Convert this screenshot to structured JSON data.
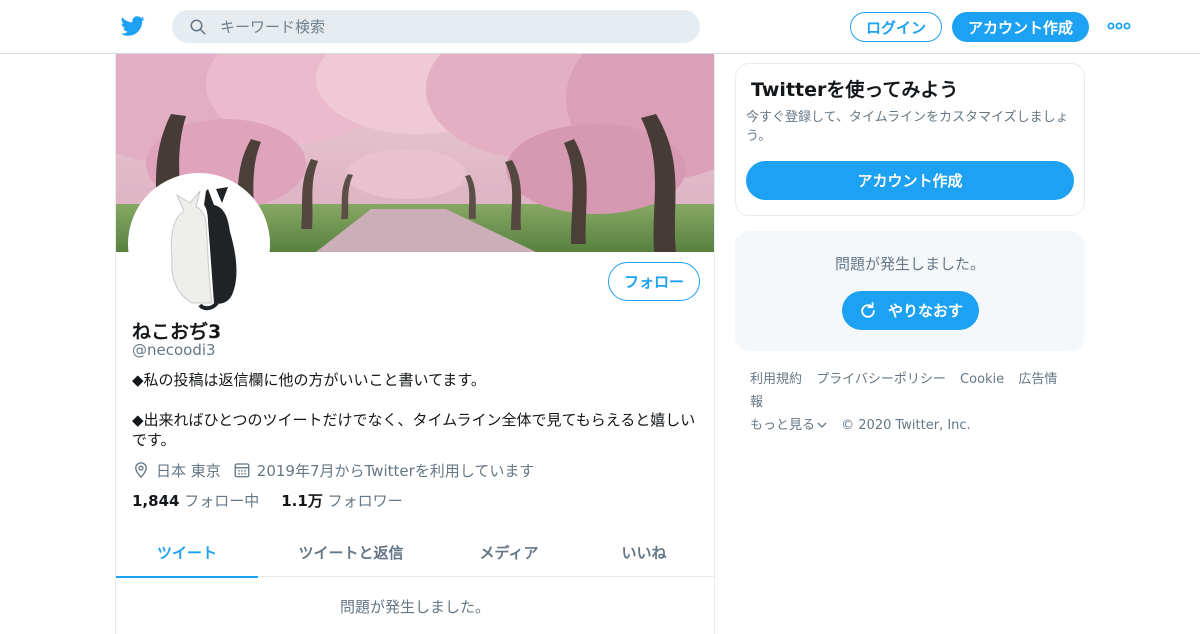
{
  "topbar": {
    "search_placeholder": "キーワード検索",
    "login_label": "ログイン",
    "signup_label": "アカウント作成"
  },
  "profile": {
    "follow_label": "フォロー",
    "display_name": "ねこおぢ3",
    "handle": "@necoodi3",
    "bio_line1": "◆私の投稿は返信欄に他の方がいいこと書いてます。",
    "bio_line2": "◆出来ればひとつのツイートだけでなく、タイムライン全体で見てもらえると嬉しいです。",
    "location": "日本 東京",
    "joined": "2019年7月からTwitterを利用しています",
    "following_count": "1,844",
    "following_label": "フォロー中",
    "followers_count": "1.1万",
    "followers_label": "フォロワー",
    "tabs": [
      {
        "label": "ツイート"
      },
      {
        "label": "ツイートと返信"
      },
      {
        "label": "メディア"
      },
      {
        "label": "いいね"
      }
    ],
    "error_text": "問題が発生しました。"
  },
  "sidebar": {
    "signup_title": "Twitterを使ってみよう",
    "signup_desc": "今すぐ登録して、タイムラインをカスタマイズしましょう。",
    "signup_button": "アカウント作成",
    "error_text": "問題が発生しました。",
    "retry_label": "やりなおす"
  },
  "footer": {
    "terms": "利用規約",
    "privacy": "プライバシーポリシー",
    "cookie": "Cookie",
    "ads": "広告情報",
    "more": "もっと見る",
    "copyright": "© 2020 Twitter, Inc."
  },
  "colors": {
    "accent": "#1da1f2",
    "secondary_text": "#657786",
    "border": "#e6ecf0"
  }
}
